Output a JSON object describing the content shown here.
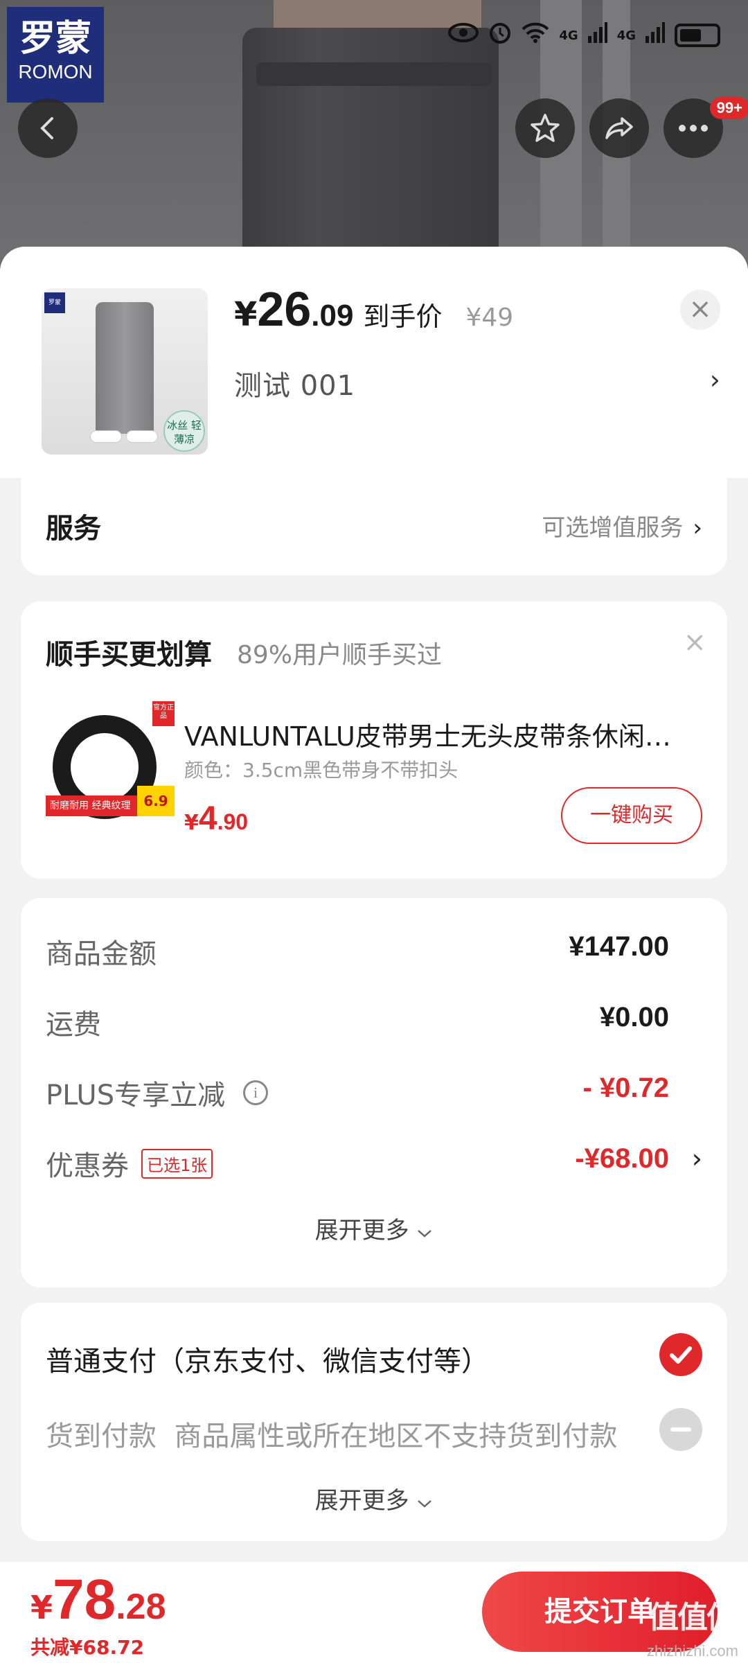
{
  "status_bar": {
    "network1": "4G",
    "network2": "4G"
  },
  "brand_logo": {
    "cn": "罗蒙",
    "en": "ROMON"
  },
  "top_actions": {
    "more_badge": "99+"
  },
  "product": {
    "price_symbol": "¥",
    "price_int": "26",
    "price_dec": ".09",
    "price_label": "到手价",
    "original_price": "¥49",
    "variant": "测试  001",
    "thumb_badge": "冰丝 轻薄凉"
  },
  "service": {
    "title": "服务",
    "hint": "可选增值服务"
  },
  "addon": {
    "title": "顺手买更划算",
    "subtitle": "89%用户顺手买过",
    "name": "VANLUNTALU皮带男士无头皮带条休闲商务",
    "spec": "颜色：3.5cm黑色带身不带扣头",
    "price_symbol": "¥",
    "price_int": "4",
    "price_dec": ".90",
    "button": "一键购买",
    "image_tag_top": "官方正品",
    "image_tag_bottom": "耐磨耐用  经典纹理",
    "image_tag_price": "6.9"
  },
  "fees": {
    "rows": [
      {
        "label": "商品金额",
        "value": "¥147.00"
      },
      {
        "label": "运费",
        "value": "¥0.00"
      },
      {
        "label": "PLUS专享立减",
        "value": "- ¥0.72"
      },
      {
        "label": "优惠券",
        "value": "-¥68.00",
        "tag": "已选1张"
      }
    ],
    "expand": "展开更多"
  },
  "payment": {
    "option1": "普通支付（京东支付、微信支付等）",
    "option2_label": "货到付款",
    "option2_note": "商品属性或所在地区不支持货到付款",
    "expand": "展开更多"
  },
  "footer": {
    "total_symbol": "¥",
    "total_int": "78",
    "total_dec": ".28",
    "saved": "共减¥68.72",
    "submit": "提交订单",
    "watermark": "值值值",
    "watermark_sub": "zhizhizhi.com"
  },
  "colors": {
    "accent": "#e0282a",
    "brand": "#1f2d7a"
  }
}
